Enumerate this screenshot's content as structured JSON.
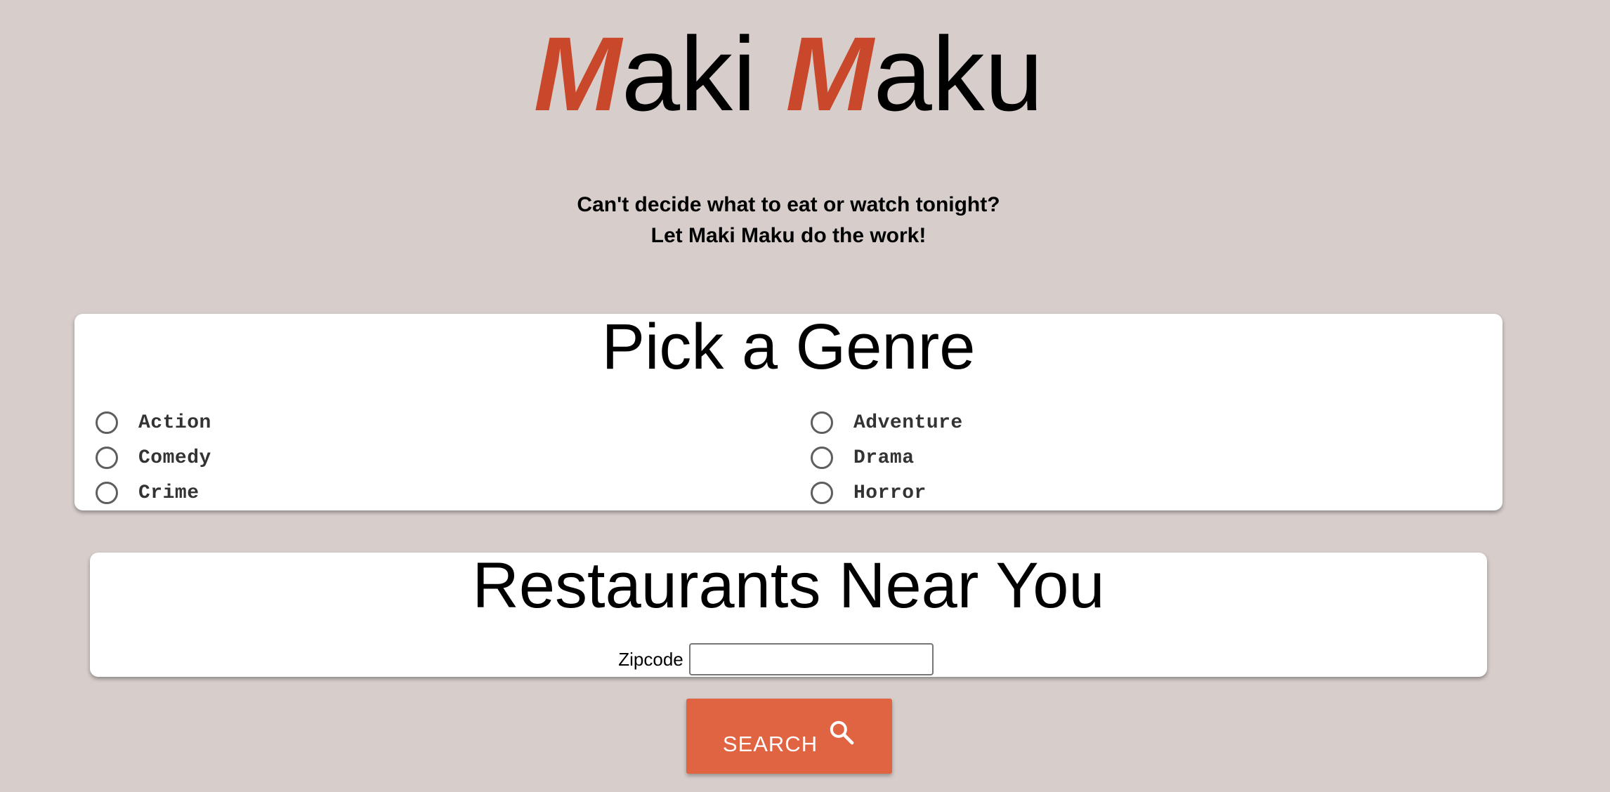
{
  "logo": {
    "word1_accent": "M",
    "word1_rest": "aki",
    "word2_accent": "M",
    "word2_rest": "aku"
  },
  "tagline": {
    "line1": "Can't decide what to eat or watch tonight?",
    "line2": "Let Maki Maku do the work!"
  },
  "genre_card": {
    "title": "Pick a Genre",
    "options": [
      {
        "label": "Action",
        "selected": false
      },
      {
        "label": "Adventure",
        "selected": false
      },
      {
        "label": "Comedy",
        "selected": false
      },
      {
        "label": "Drama",
        "selected": false
      },
      {
        "label": "Crime",
        "selected": false
      },
      {
        "label": "Horror",
        "selected": false
      }
    ]
  },
  "restaurant_card": {
    "title": "Restaurants Near You",
    "zip_label": "Zipcode",
    "zip_value": ""
  },
  "search_button": {
    "label": "SEARCH",
    "icon": "search-icon"
  },
  "colors": {
    "background": "#d7cecb",
    "brand_accent": "#c9472a",
    "button": "#e06442",
    "card": "#ffffff"
  }
}
